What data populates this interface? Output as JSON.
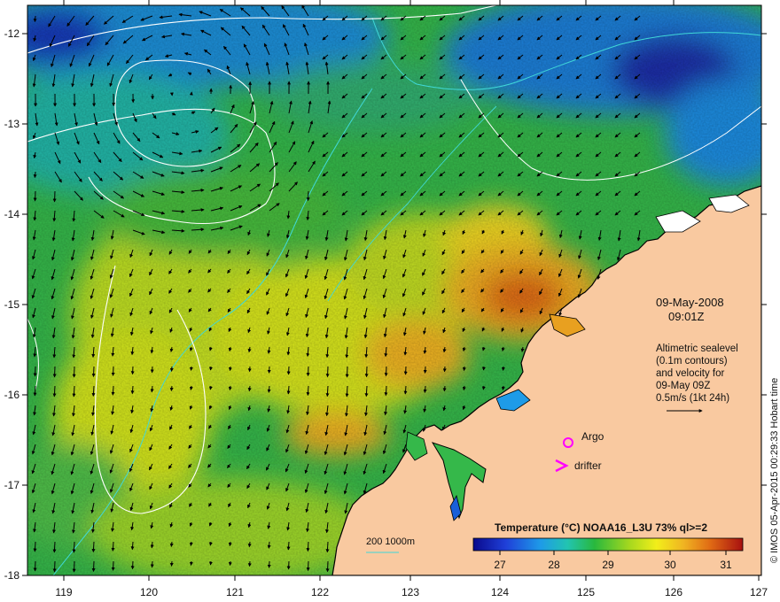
{
  "map": {
    "lon_ticks": [
      "119",
      "120",
      "121",
      "122",
      "123",
      "124",
      "125",
      "126",
      "127"
    ],
    "lat_ticks": [
      "-12",
      "-13",
      "-14",
      "-15",
      "-16",
      "-17",
      "-18"
    ],
    "lon_range": [
      118.6,
      127.0
    ],
    "lat_range": [
      -11.8,
      -18.0
    ]
  },
  "annotation": {
    "date": "09-May-2008",
    "time": "09:01Z",
    "description_lines": [
      "Altimetric sealevel",
      "(0.1m contours)",
      "and velocity for",
      "09-May 09Z",
      "0.5m/s (1kt 24h)"
    ]
  },
  "markers": {
    "argo_label": "Argo",
    "drifter_label": "drifter",
    "marker_color": "#ff00ff"
  },
  "depth_legend": "200  1000m",
  "colorbar": {
    "title": "Temperature (°C) NOAA16_L3U 73% ql>=2",
    "ticks": [
      "27",
      "28",
      "29",
      "30",
      "31"
    ],
    "range": [
      26.5,
      31.5
    ]
  },
  "credit": "© IMOS 05-Apr-2015 00:29:33 Hobart time",
  "colors": {
    "land": "#f9c9a0",
    "coast": "#000000",
    "contour": "#ffffff",
    "bathymetry": "#40d8d8",
    "arrow": "#000000"
  }
}
